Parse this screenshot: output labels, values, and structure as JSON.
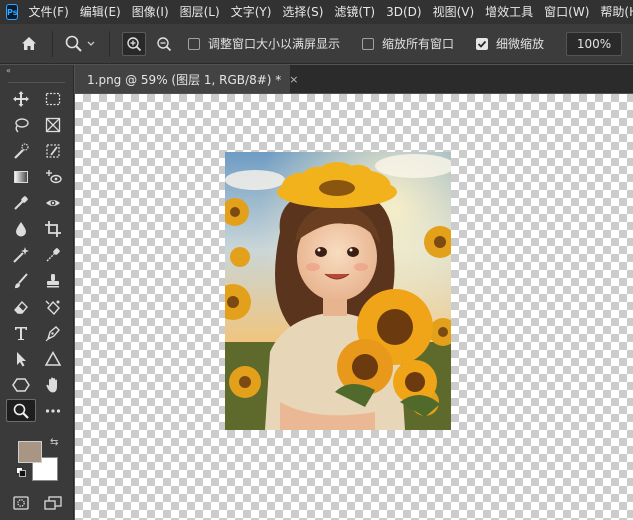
{
  "app": {
    "logo_text": "Ps",
    "menu": [
      "文件(F)",
      "编辑(E)",
      "图像(I)",
      "图层(L)",
      "文字(Y)",
      "选择(S)",
      "滤镜(T)",
      "3D(D)",
      "视图(V)",
      "增效工具",
      "窗口(W)",
      "帮助(H)"
    ]
  },
  "options": {
    "resize_windows_label": "调整窗口大小以满屏显示",
    "resize_windows_checked": false,
    "zoom_all_label": "缩放所有窗口",
    "zoom_all_checked": false,
    "scrubby_zoom_label": "细微缩放",
    "scrubby_zoom_checked": true,
    "zoom_value": "100%"
  },
  "document": {
    "tab_title": "1.png @ 59% (图层 1, RGB/8#) *",
    "close_glyph": "×"
  },
  "toolbar": {
    "collapse_glyph": "«",
    "swap_glyph": "⇆",
    "foreground_color": "#a89584",
    "background_color": "#ffffff",
    "tools": [
      "move-icon",
      "marquee-icon",
      "lasso-icon",
      "frame-icon",
      "quick-select-icon",
      "slice-icon",
      "gradient-icon",
      "content-aware-move-icon",
      "eyedropper-icon",
      "red-eye-icon",
      "blur-icon",
      "crop-icon",
      "magic-wand-icon",
      "eyedropper-alt-icon",
      "brush-icon",
      "stamp-icon",
      "eraser-icon",
      "background-eraser-icon",
      "type-icon",
      "pen-icon",
      "path-select-icon",
      "triangle-icon",
      "polygon-icon",
      "hand-icon",
      "zoom-icon",
      "more-icon"
    ]
  }
}
